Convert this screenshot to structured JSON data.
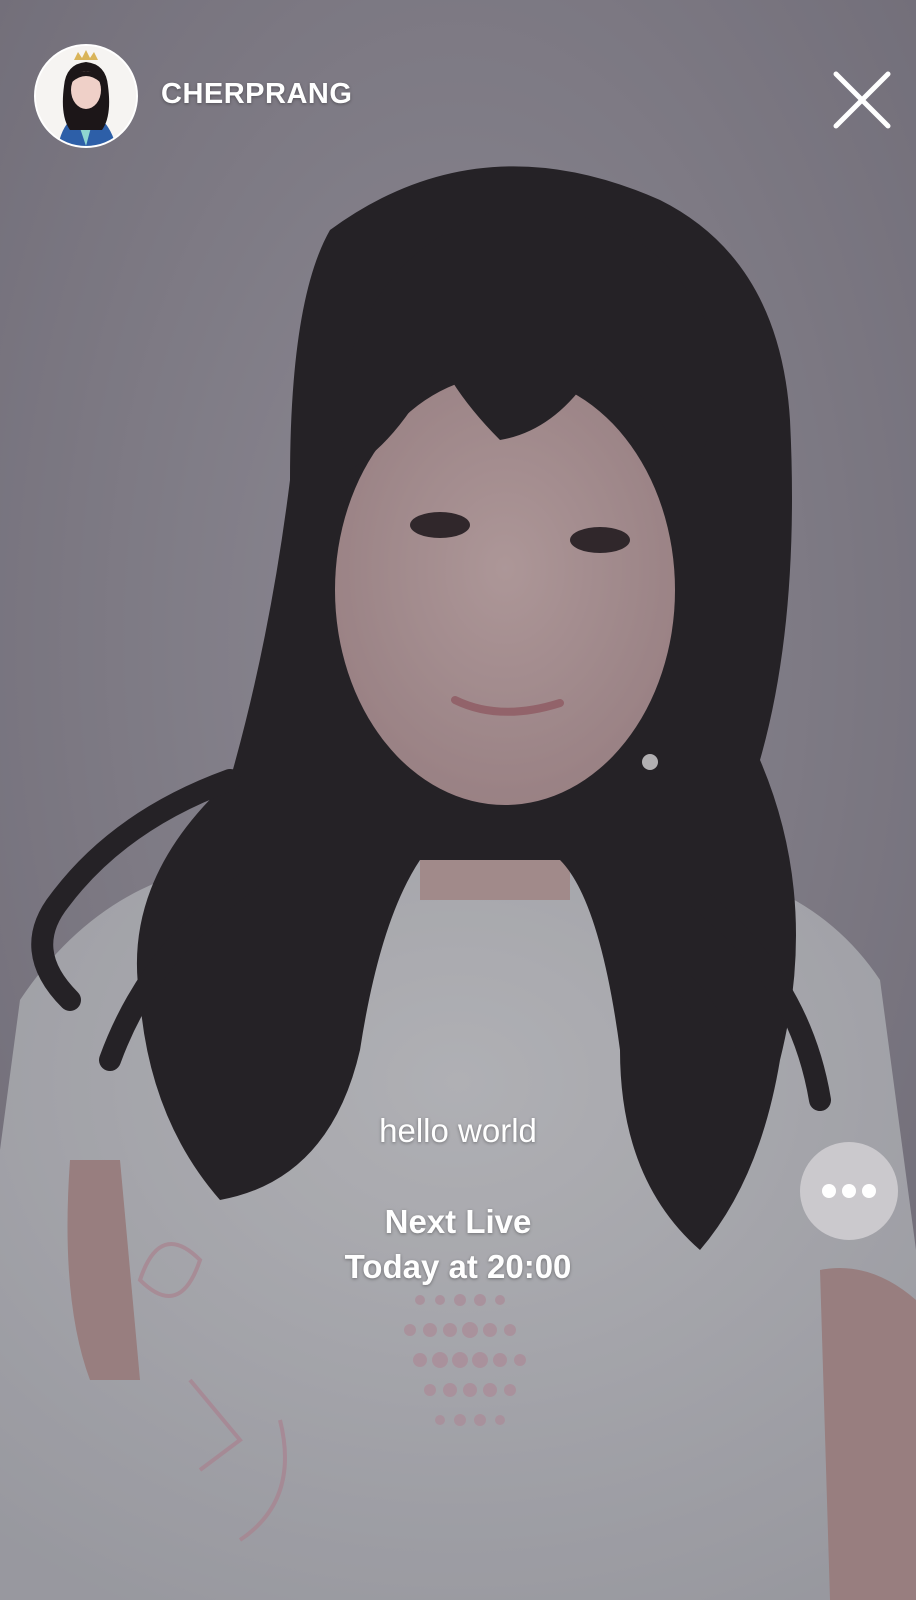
{
  "header": {
    "username": "CHERPRANG",
    "avatar_icon": "profile-avatar",
    "close_icon": "close-icon"
  },
  "content": {
    "message": "hello world",
    "next_live_label": "Next Live",
    "next_live_time": "Today at 20:00"
  },
  "controls": {
    "more_icon": "more-dots-icon"
  },
  "colors": {
    "text": "#ffffff",
    "overlay": "#3c3a42",
    "more_button": "#d2d0d4"
  }
}
